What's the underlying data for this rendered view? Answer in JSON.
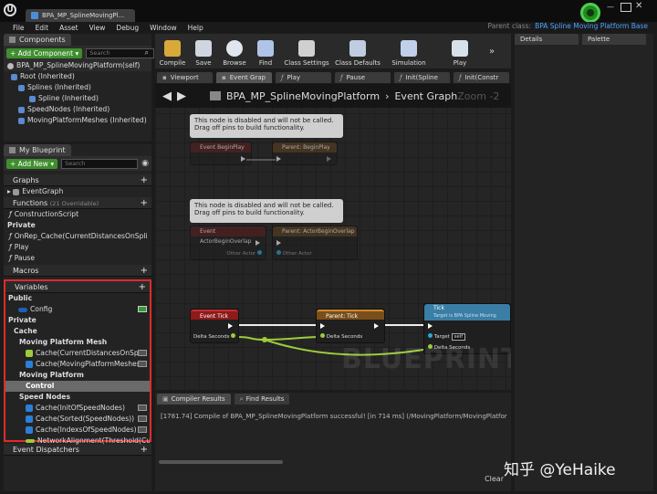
{
  "window": {
    "title": "BPA_MP_SplineMovingPl...",
    "parent_label": "Parent class:",
    "parent_value": "BPA Spline Moving Platform Base"
  },
  "menu": [
    "File",
    "Edit",
    "Asset",
    "View",
    "Debug",
    "Window",
    "Help"
  ],
  "components": {
    "tab": "Components",
    "add_label": "+ Add Component",
    "add_caret": "▾",
    "search_placeholder": "Search",
    "root": "BPA_MP_SplineMovingPlatform(self)",
    "items": [
      {
        "label": "Root (Inherited)",
        "indent": 8
      },
      {
        "label": "Splines (Inherited)",
        "indent": 16
      },
      {
        "label": "Spline (Inherited)",
        "indent": 28
      },
      {
        "label": "SpeedNodes (Inherited)",
        "indent": 16
      },
      {
        "label": "MovingPlatformMeshes (Inherited)",
        "indent": 16
      }
    ]
  },
  "blueprint": {
    "tab": "My Blueprint",
    "add_label": "+ Add New",
    "add_caret": "▾",
    "search_placeholder": "Search",
    "graphs_header": "Graphs",
    "event_graph": "EventGraph",
    "functions_header": "Functions",
    "functions_note": "(21 Overridable)",
    "construction": "ConstructionScript",
    "private": "Private",
    "functions": [
      "OnRep_Cache(CurrentDistancesOnSpli",
      "Play",
      "Pause"
    ],
    "macros_header": "Macros",
    "variables_header": "Variables",
    "public": "Public",
    "config": "Config",
    "private2": "Private",
    "cache": "Cache",
    "moving_platform_mesh": "Moving Platform Mesh",
    "cache_items": [
      "Cache(CurrentDistancesOnSpli",
      "Cache(MovingPlatformMeshes"
    ],
    "moving_platform": "Moving Platform",
    "control": "Control",
    "speed_nodes": "Speed Nodes",
    "speed_items": [
      "Cache(InitOfSpeedNodes)",
      "Cache(Sorted(SpeedNodes))",
      "Cache(IndexsOfSpeedNodes)"
    ],
    "network": "NetworkAlignment(Threshold(Curr",
    "dispatchers_header": "Event Dispatchers"
  },
  "toolbar": [
    {
      "label": "Compile",
      "icon": "gear-icon"
    },
    {
      "label": "Save",
      "icon": "save-icon"
    },
    {
      "label": "Browse",
      "icon": "magnifier-icon"
    },
    {
      "label": "Find",
      "icon": "binoculars-icon"
    },
    {
      "label": "Class Settings",
      "icon": "gears-icon"
    },
    {
      "label": "Class Defaults",
      "icon": "defaults-icon"
    },
    {
      "label": "Simulation",
      "icon": "simulation-icon"
    },
    {
      "label": "Play",
      "icon": "play-icon"
    }
  ],
  "graph_tabs": [
    "Viewport",
    "Event Grap",
    "Play",
    "Pause",
    "Init(Spline",
    "Init(Constr"
  ],
  "graph": {
    "breadcrumb": "BPA_MP_SplineMovingPlatform",
    "sep": "›",
    "current": "Event Graph",
    "zoom": "Zoom -2",
    "watermark": "BLUEPRINT",
    "disabled_note": "This node is disabled and will not be called. Drag off pins to build functionality.",
    "nodes": {
      "begin_play": "Event BeginPlay",
      "parent_begin": "Parent: BeginPlay",
      "actor_overlap": "Event ActorBeginOverlap",
      "parent_overlap": "Parent: ActorBeginOverlap",
      "other_actor": "Other Actor",
      "event_tick": "Event Tick",
      "delta": "Delta Seconds",
      "parent_tick": "Parent: Tick",
      "tick": "Tick",
      "tick_sub": "Target is BPA Spline Moving",
      "target": "Target",
      "self": "self"
    }
  },
  "bottom": {
    "tabs": [
      "Compiler Results",
      "Find Results"
    ],
    "message": "[1781.74] Compile of BPA_MP_SplineMovingPlatform successful! [in 714 ms] (/MovingPlatform/MovingPlatform",
    "clear": "Clear"
  },
  "right": {
    "tabs": [
      "Details",
      "Palette"
    ]
  },
  "watermark": "知乎 @YeHaike"
}
